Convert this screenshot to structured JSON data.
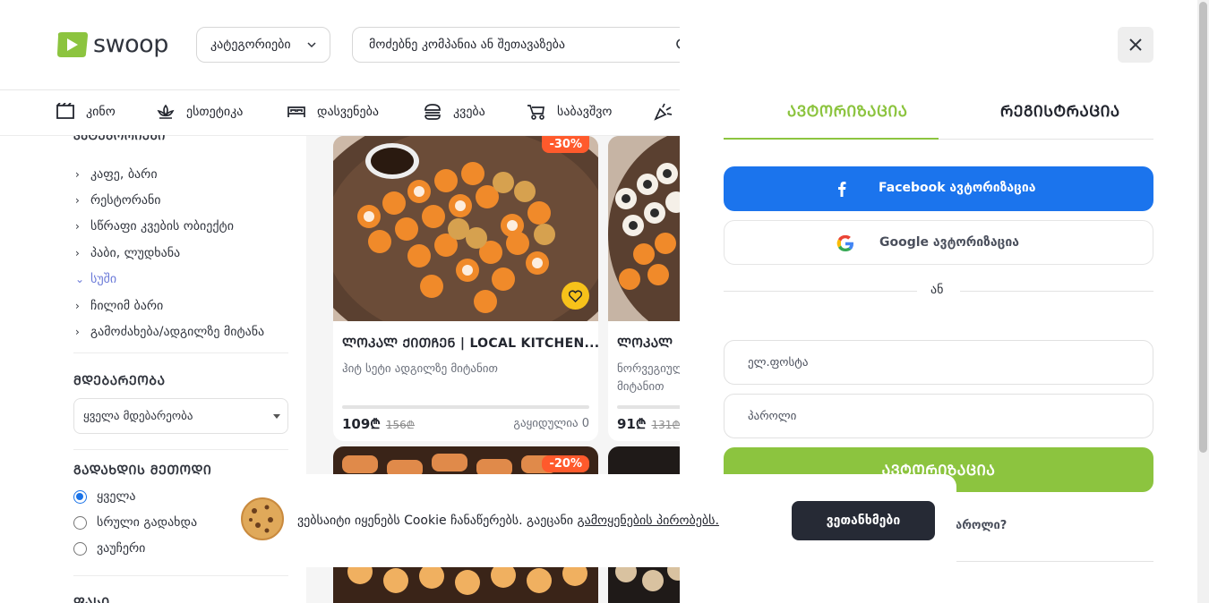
{
  "header": {
    "logo_text": "swoop",
    "categories_label": "კატეგორიები",
    "search_placeholder": "მოძებნე კომპანია ან შეთავაზება"
  },
  "nav": {
    "items": [
      {
        "label": "კინო",
        "icon": "ticket-icon"
      },
      {
        "label": "ესთეტიკა",
        "icon": "lotus-icon"
      },
      {
        "label": "დასვენება",
        "icon": "bed-icon"
      },
      {
        "label": "კვება",
        "icon": "burger-icon"
      },
      {
        "label": "საბავშვო",
        "icon": "stroller-icon"
      },
      {
        "label": "",
        "icon": "party-popper-icon"
      }
    ]
  },
  "sidebar": {
    "categories_title_cut": "ᲙᲐᲢᲔᲒᲝᲠᲘᲔᲑᲘ",
    "categories": [
      {
        "label": "კაფე, ბარი",
        "active": false
      },
      {
        "label": "რესტორანი",
        "active": false
      },
      {
        "label": "სწრაფი კვების ობიექტი",
        "active": false
      },
      {
        "label": "პაბი, ლუდხანა",
        "active": false
      },
      {
        "label": "სუში",
        "active": true
      },
      {
        "label": "ჩილიმ ბარი",
        "active": false
      },
      {
        "label": "გამოძახება/ადგილზე მიტანა",
        "active": false
      }
    ],
    "location_title": "ᲛᲓᲔᲑᲐᲠᲔᲝᲑᲐ",
    "location_value": "ყველა მდებარეობა",
    "payment_title": "ᲒᲐᲓᲐᲮᲓᲘᲡ ᲛᲔᲗᲝᲓᲘ",
    "payment_options": [
      {
        "label": "ყველა",
        "checked": true
      },
      {
        "label": "სრული გადახდა",
        "checked": false
      },
      {
        "label": "ვაუჩერი",
        "checked": false
      }
    ],
    "price_title_cut": "ᲤᲐᲡᲘ"
  },
  "cards": [
    {
      "badge": "-30%",
      "title": "ᲚᲝᲙᲐᲚ ᲥᲘᲗᲩᲔᲜ | LOCAL KITCHEN...",
      "subtitle": "ჰიტ სეტი ადგილზე მიტანით",
      "price": "109₾",
      "old_price": "156₾",
      "sold": "გაყიდულია 0",
      "sold_progress": 0
    },
    {
      "title": "ᲚᲝᲙᲐᲚ",
      "subtitle_line1": "ნორვეგიული",
      "subtitle_line2": "მიტანით",
      "price": "91₾",
      "old_price": "131₾",
      "sold_progress": 0
    },
    {
      "badge": "-20%"
    }
  ],
  "panel": {
    "tab_login": "ᲐᲕᲢᲝᲠᲘᲖᲐᲪᲘᲐ",
    "tab_register": "ᲠᲔᲒᲘᲡᲢᲠᲐᲪᲘᲐ",
    "facebook_label": "Facebook ავტორიზაცია",
    "google_label": "Google ავტორიზაცია",
    "or_text": "ან",
    "email_placeholder": "ელ.ფოსტა",
    "password_placeholder": "პაროლი",
    "login_button": "ᲐᲕᲢᲝᲠᲘᲖᲐᲪᲘᲐ",
    "forgot_cut": "აროლი?"
  },
  "cookie": {
    "text": "ვებსაიტი იყენებს Cookie ჩანაწერებს. გაეცანი ",
    "link": "გამოყენების პირობებს.",
    "agree": "ვეთანხმები"
  },
  "colors": {
    "brand_green": "#8cc43f",
    "facebook_blue": "#1b74ed",
    "badge_orange": "#ff5a2c",
    "favorite_yellow": "#f7c21a",
    "active_category": "#6b7ad8",
    "dark_button": "#262a35"
  }
}
